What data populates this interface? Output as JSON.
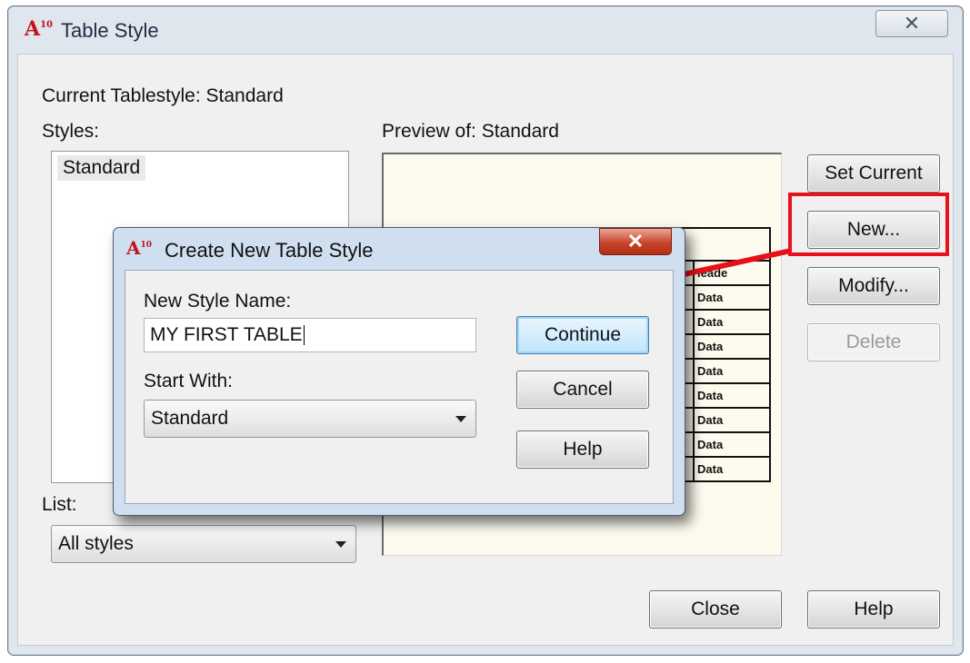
{
  "window": {
    "title": "Table Style",
    "close_glyph": "✕"
  },
  "app_logo": {
    "letter": "A",
    "version": "10"
  },
  "current_tablestyle": "Current Tablestyle: Standard",
  "styles": {
    "label": "Styles:",
    "items": [
      "Standard"
    ]
  },
  "list": {
    "label": "List:",
    "selected": "All styles"
  },
  "preview": {
    "label": "Preview of: Standard",
    "visible_header_fragment": "leade",
    "data_cell": "Data",
    "data_rows": 8
  },
  "buttons": {
    "set_current": "Set Current",
    "new": "New...",
    "modify": "Modify...",
    "delete": "Delete",
    "close": "Close",
    "help": "Help"
  },
  "dialog": {
    "title": "Create New Table Style",
    "close_glyph": "✕",
    "new_style_name_label": "New Style Name:",
    "new_style_name_value": "MY FIRST TABLE",
    "start_with_label": "Start With:",
    "start_with_value": "Standard",
    "continue": "Continue",
    "cancel": "Cancel",
    "help": "Help"
  },
  "annotation": {
    "color": "#e8111b"
  }
}
